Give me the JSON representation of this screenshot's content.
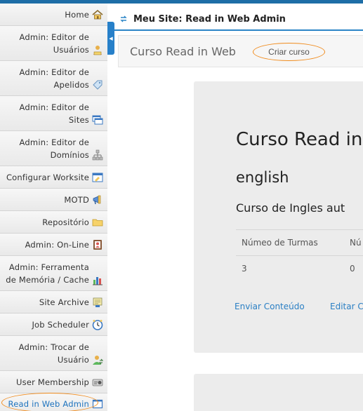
{
  "page": {
    "title": "Meu Site: Read in Web Admin"
  },
  "sidebar": {
    "items": [
      {
        "label": "Home",
        "icon": "home-icon"
      },
      {
        "label": "Admin: Editor de Usuários",
        "icon": "user-edit-icon"
      },
      {
        "label": "Admin: Editor de Apelidos",
        "icon": "tag-icon"
      },
      {
        "label": "Admin: Editor de Sites",
        "icon": "sites-icon"
      },
      {
        "label": "Admin: Editor de Domínios",
        "icon": "network-icon"
      },
      {
        "label": "Configurar Worksite",
        "icon": "worksite-icon"
      },
      {
        "label": "MOTD",
        "icon": "megaphone-icon"
      },
      {
        "label": "Repositório",
        "icon": "folder-icon"
      },
      {
        "label": "Admin: On-Line",
        "icon": "contact-icon"
      },
      {
        "label": "Admin: Ferramenta de Memória / Cache",
        "icon": "memory-chart-icon"
      },
      {
        "label": "Site Archive",
        "icon": "archive-icon"
      },
      {
        "label": "Job Scheduler",
        "icon": "clock-icon"
      },
      {
        "label": "Admin: Trocar de Usuário",
        "icon": "switch-user-icon"
      },
      {
        "label": "User Membership",
        "icon": "membership-icon"
      },
      {
        "label": "Read in Web Admin",
        "icon": "window-icon",
        "active": true
      }
    ]
  },
  "toolbar": {
    "title": "Curso Read in Web",
    "create_label": "Criar curso"
  },
  "course_card": {
    "title": "Curso Read in Web",
    "language": "english",
    "description": "Curso de Ingles aut",
    "table": {
      "headers": [
        "Númeo de Turmas",
        "Nú"
      ],
      "rows": [
        [
          "3",
          "0"
        ]
      ]
    },
    "links": [
      "Enviar Conteúdo",
      "Editar C"
    ]
  },
  "colors": {
    "accent": "#2b85c7",
    "highlight": "#f08c1e",
    "topbar": "#1e6ea7"
  }
}
